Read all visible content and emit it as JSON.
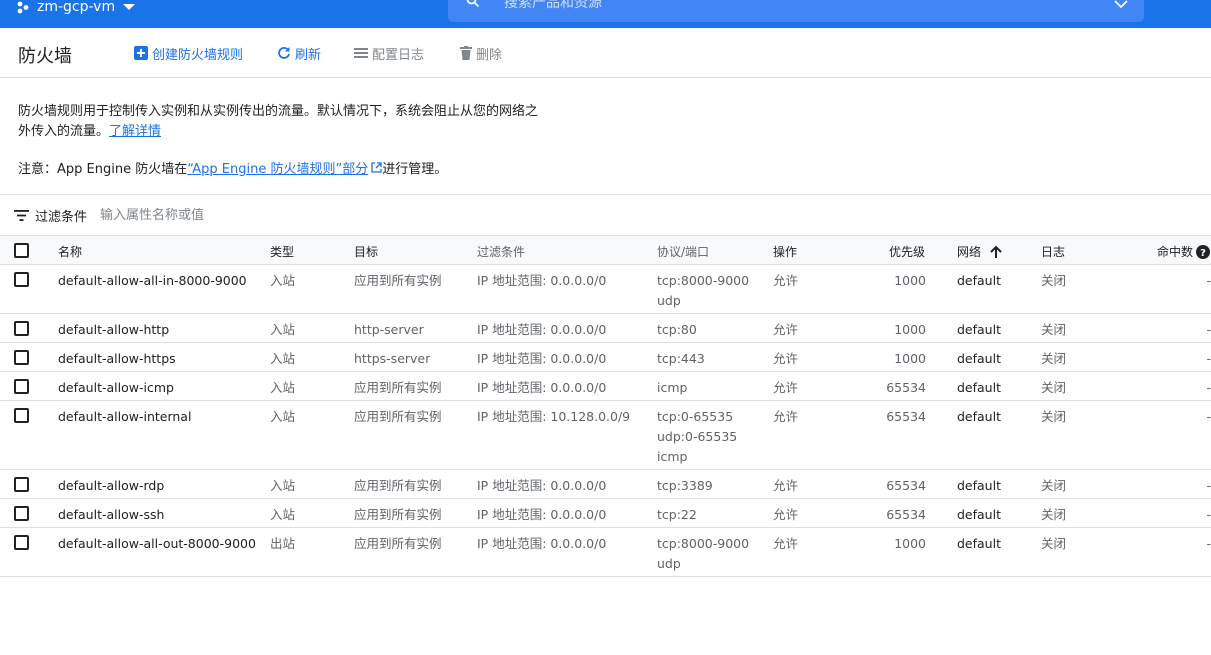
{
  "topbar": {
    "project": "zm-gcp-vm",
    "search_placeholder": "搜索产品和资源"
  },
  "header": {
    "title": "防火墙",
    "create_label": "创建防火墙规则",
    "refresh_label": "刷新",
    "logs_label": "配置日志",
    "delete_label": "删除"
  },
  "intro": {
    "text": "防火墙规则用于控制传入实例和从实例传出的流量。默认情况下，系统会阻止从您的网络之外传入的流量。",
    "link": "了解详情"
  },
  "note": {
    "prefix": "注意：App Engine 防火墙在",
    "link": "“App Engine 防火墙规则”部分",
    "suffix": "进行管理。"
  },
  "filter": {
    "label": "过滤条件",
    "placeholder": "输入属性名称或值"
  },
  "table": {
    "headers": {
      "name": "名称",
      "type": "类型",
      "target": "目标",
      "filter": "过滤条件",
      "protocol": "协议/端口",
      "action": "操作",
      "priority": "优先级",
      "network": "网络",
      "log": "日志",
      "hits": "命中数"
    },
    "rows": [
      {
        "name": "default-allow-all-in-8000-9000",
        "type": "入站",
        "target": "应用到所有实例",
        "filter": "IP 地址范围: 0.0.0.0/0",
        "protocol": [
          "tcp:8000-9000",
          "udp"
        ],
        "action": "允许",
        "priority": "1000",
        "network": "default",
        "log": "关闭",
        "hits": "-"
      },
      {
        "name": "default-allow-http",
        "type": "入站",
        "target": "http-server",
        "filter": "IP 地址范围: 0.0.0.0/0",
        "protocol": [
          "tcp:80"
        ],
        "action": "允许",
        "priority": "1000",
        "network": "default",
        "log": "关闭",
        "hits": "-"
      },
      {
        "name": "default-allow-https",
        "type": "入站",
        "target": "https-server",
        "filter": "IP 地址范围: 0.0.0.0/0",
        "protocol": [
          "tcp:443"
        ],
        "action": "允许",
        "priority": "1000",
        "network": "default",
        "log": "关闭",
        "hits": "-"
      },
      {
        "name": "default-allow-icmp",
        "type": "入站",
        "target": "应用到所有实例",
        "filter": "IP 地址范围: 0.0.0.0/0",
        "protocol": [
          "icmp"
        ],
        "action": "允许",
        "priority": "65534",
        "network": "default",
        "log": "关闭",
        "hits": "-"
      },
      {
        "name": "default-allow-internal",
        "type": "入站",
        "target": "应用到所有实例",
        "filter": "IP 地址范围: 10.128.0.0/9",
        "protocol": [
          "tcp:0-65535",
          "udp:0-65535",
          "icmp"
        ],
        "action": "允许",
        "priority": "65534",
        "network": "default",
        "log": "关闭",
        "hits": "-"
      },
      {
        "name": "default-allow-rdp",
        "type": "入站",
        "target": "应用到所有实例",
        "filter": "IP 地址范围: 0.0.0.0/0",
        "protocol": [
          "tcp:3389"
        ],
        "action": "允许",
        "priority": "65534",
        "network": "default",
        "log": "关闭",
        "hits": "-"
      },
      {
        "name": "default-allow-ssh",
        "type": "入站",
        "target": "应用到所有实例",
        "filter": "IP 地址范围: 0.0.0.0/0",
        "protocol": [
          "tcp:22"
        ],
        "action": "允许",
        "priority": "65534",
        "network": "default",
        "log": "关闭",
        "hits": "-"
      },
      {
        "name": "default-allow-all-out-8000-9000",
        "type": "出站",
        "target": "应用到所有实例",
        "filter": "IP 地址范围: 0.0.0.0/0",
        "protocol": [
          "tcp:8000-9000",
          "udp"
        ],
        "action": "允许",
        "priority": "1000",
        "network": "default",
        "log": "关闭",
        "hits": "-"
      }
    ]
  },
  "colors": {
    "brand": "#1a73e8",
    "search": "#4285f4",
    "muted": "#5f6368",
    "divider": "#e0e0e0"
  },
  "icons": [
    "project-icon",
    "search-icon",
    "add-icon",
    "refresh-icon",
    "logs-icon",
    "delete-icon",
    "external-link-icon",
    "filter-icon",
    "sort-arrow-up-icon",
    "help-icon"
  ]
}
